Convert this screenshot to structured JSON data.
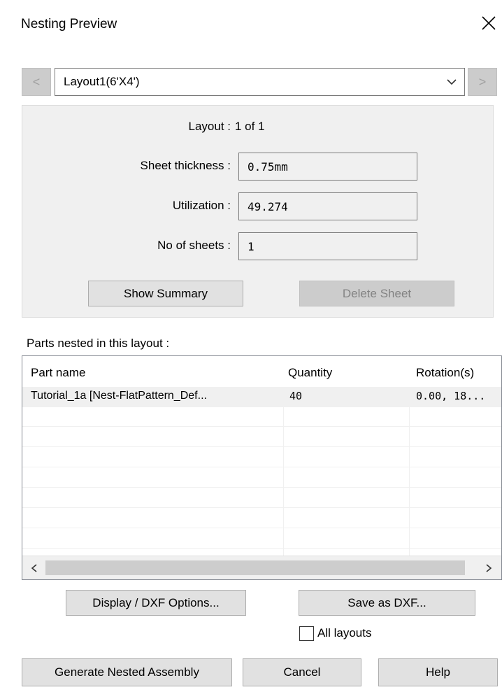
{
  "window": {
    "title": "Nesting Preview",
    "close_icon": "close-icon"
  },
  "layout_selector": {
    "prev_label": "<",
    "next_label": ">",
    "selected": "Layout1(6'X4')"
  },
  "details": {
    "layout_label": "Layout :",
    "layout_value": "1 of 1",
    "thickness_label": "Sheet thickness :",
    "thickness_value": "0.75mm",
    "utilization_label": "Utilization :",
    "utilization_value": "49.274",
    "sheets_label": "No of sheets :",
    "sheets_value": "1",
    "show_summary": "Show Summary",
    "delete_sheet": "Delete Sheet"
  },
  "parts": {
    "heading": "Parts nested in this layout :",
    "columns": [
      "Part name",
      "Quantity",
      "Rotation(s)"
    ],
    "rows": [
      {
        "name": "Tutorial_1a [Nest-FlatPattern_Def...",
        "quantity": "40",
        "rotation": "0.00, 18..."
      }
    ]
  },
  "dxf": {
    "display_options": "Display / DXF Options...",
    "save_as_dxf": "Save as DXF...",
    "all_layouts": "All layouts"
  },
  "footer": {
    "generate": "Generate Nested Assembly",
    "cancel": "Cancel",
    "help": "Help"
  },
  "colors": {
    "button_face": "#e1e1e1",
    "panel": "#f0f0f0",
    "disabled_text": "#838383"
  }
}
